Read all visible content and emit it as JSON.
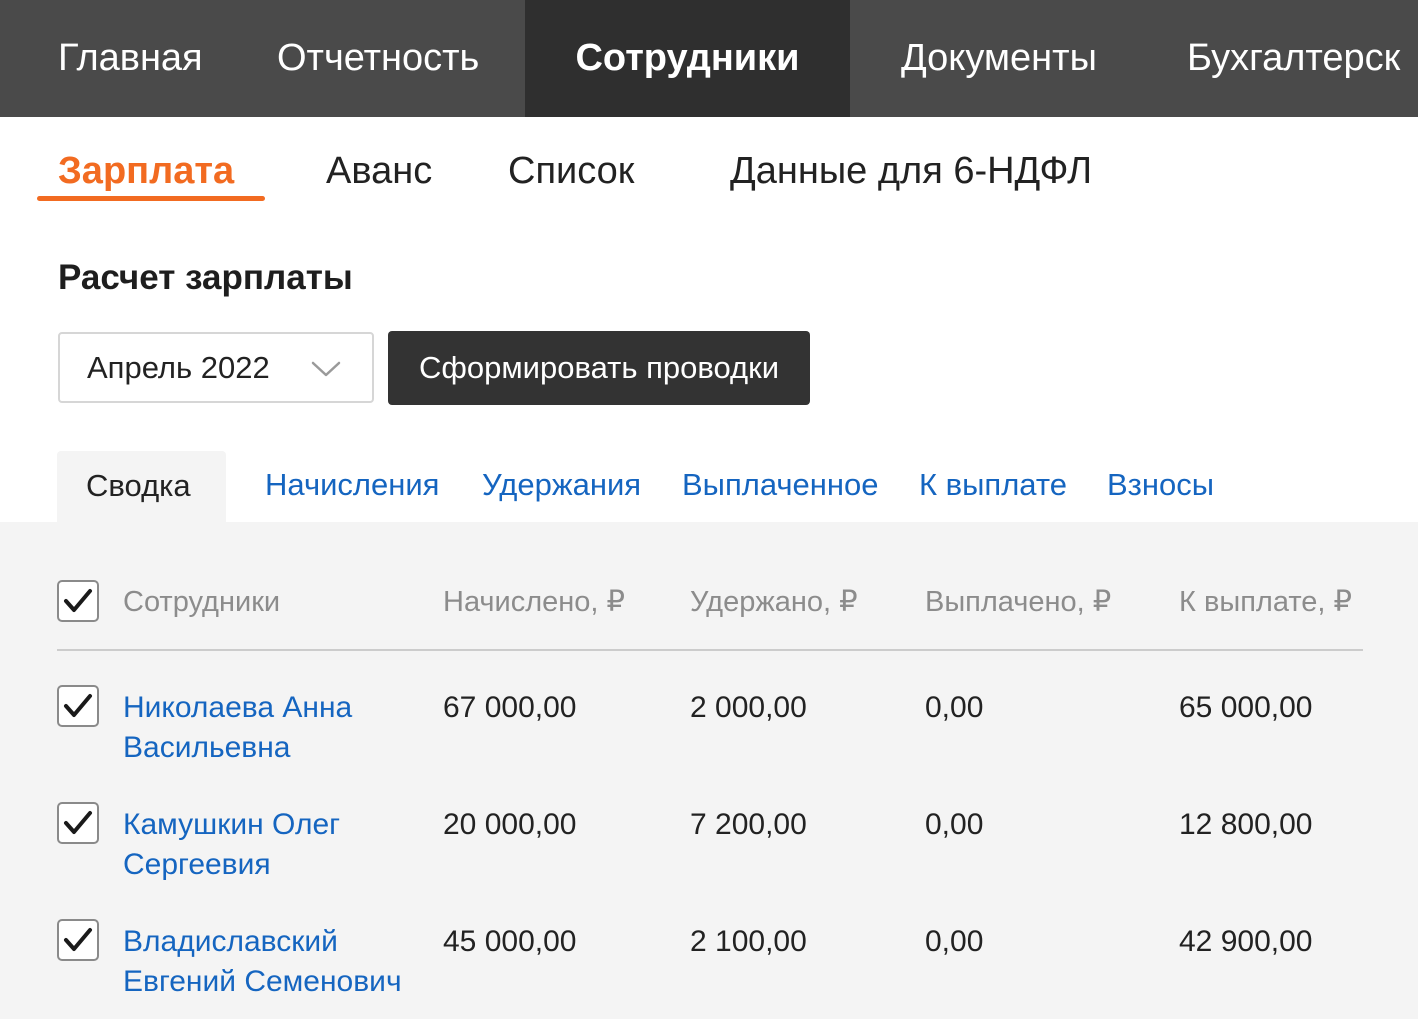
{
  "top_nav": {
    "items": [
      {
        "label": "Главная",
        "active": false
      },
      {
        "label": "Отчетность",
        "active": false
      },
      {
        "label": "Сотрудники",
        "active": true
      },
      {
        "label": "Документы",
        "active": false
      },
      {
        "label": "Бухгалтерск",
        "active": false
      }
    ]
  },
  "sub_tabs": [
    {
      "label": "Зарплата",
      "active": true
    },
    {
      "label": "Аванс",
      "active": false
    },
    {
      "label": "Список",
      "active": false
    },
    {
      "label": "Данные для 6-НДФЛ",
      "active": false
    }
  ],
  "page_title": "Расчет зарплаты",
  "controls": {
    "month_value": "Апрель 2022",
    "generate_label": "Сформировать проводки"
  },
  "content_tabs": [
    {
      "label": "Сводка",
      "active": true
    },
    {
      "label": "Начисления",
      "active": false
    },
    {
      "label": "Удержания",
      "active": false
    },
    {
      "label": "Выплаченное",
      "active": false
    },
    {
      "label": "К выплате",
      "active": false
    },
    {
      "label": "Взносы",
      "active": false
    }
  ],
  "table": {
    "select_all_checked": true,
    "columns": [
      "Сотрудники",
      "Начислено, ₽",
      "Удержано, ₽",
      "Выплачено, ₽",
      "К выплате, ₽"
    ],
    "rows": [
      {
        "checked": true,
        "name": "Николаева Анна Васильевна",
        "accrued": "67 000,00",
        "withheld": "2 000,00",
        "paid": "0,00",
        "to_pay": "65 000,00"
      },
      {
        "checked": true,
        "name": "Камушкин Олег Сергеевия",
        "accrued": "20 000,00",
        "withheld": "7 200,00",
        "paid": "0,00",
        "to_pay": "12 800,00"
      },
      {
        "checked": true,
        "name": "Владиславский Евгений Семенович",
        "accrued": "45 000,00",
        "withheld": "2 100,00",
        "paid": "0,00",
        "to_pay": "42 900,00"
      }
    ]
  },
  "colors": {
    "nav_bg": "#4a4a4a",
    "nav_active_bg": "#2f2f2f",
    "accent": "#f26b21",
    "link": "#1565c0",
    "button_bg": "#333333",
    "panel_bg": "#f4f4f4"
  },
  "icons": {
    "dropdown": "chevron-down-icon",
    "checkbox": "checkmark-icon"
  }
}
